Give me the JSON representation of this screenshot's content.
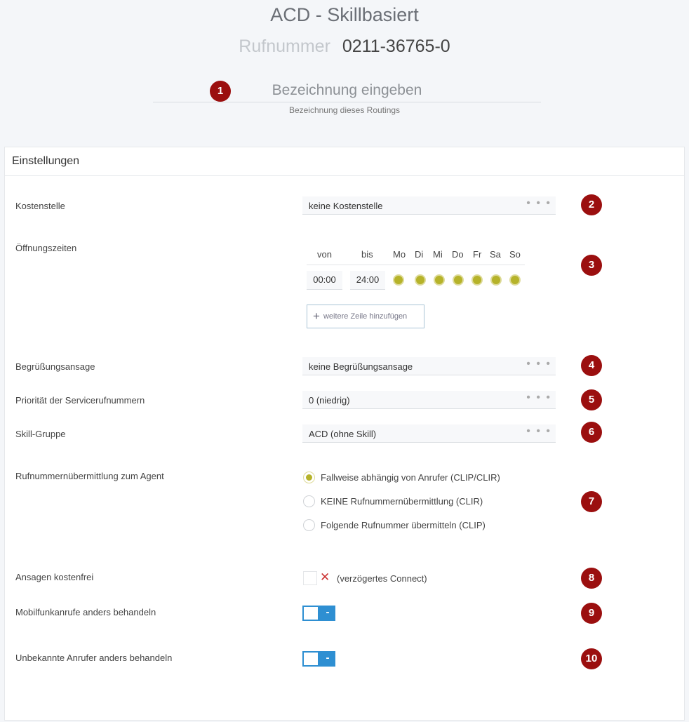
{
  "header": {
    "title": "ACD - Skillbasiert",
    "phone_label": "Rufnummer",
    "phone_value": "0211-36765-0",
    "name_placeholder": "Bezeichnung eingeben",
    "name_hint": "Bezeichnung dieses Routings"
  },
  "badges": [
    "1",
    "2",
    "3",
    "4",
    "5",
    "6",
    "7",
    "8",
    "9",
    "10"
  ],
  "panel": {
    "title": "Einstellungen"
  },
  "settings": {
    "cost_center": {
      "label": "Kostenstelle",
      "value": "keine Kostenstelle"
    },
    "opening_hours": {
      "label": "Öffnungszeiten",
      "col_from": "von",
      "col_to": "bis",
      "days": [
        "Mo",
        "Di",
        "Mi",
        "Do",
        "Fr",
        "Sa",
        "So"
      ],
      "from": "00:00",
      "to": "24:00",
      "add_row_label": "weitere Zeile hinzufügen"
    },
    "greeting": {
      "label": "Begrüßungsansage",
      "value": "keine Begrüßungsansage"
    },
    "priority": {
      "label": "Priorität der Servicerufnummern",
      "value": "0 (niedrig)"
    },
    "skill_group": {
      "label": "Skill-Gruppe",
      "value": "ACD (ohne Skill)"
    },
    "caller_id": {
      "label": "Rufnummernübermittlung zum Agent",
      "options": [
        "Fallweise abhängig von Anrufer (CLIP/CLIR)",
        "KEINE Rufnummernübermittlung (CLIR)",
        "Folgende Rufnummer übermitteln (CLIP)"
      ],
      "selected_index": 0
    },
    "free_announcements": {
      "label": "Ansagen kostenfrei",
      "checkbox_text": "(verzögertes Connect)",
      "checked": false
    },
    "mobile_calls": {
      "label": "Mobilfunkanrufe anders behandeln",
      "state": "-"
    },
    "unknown_callers": {
      "label": "Unbekannte Anrufer anders behandeln",
      "state": "-"
    }
  },
  "colors": {
    "accent": "#2e8fd2",
    "badge": "#9b0f0f",
    "day_active": "#b6b32a"
  }
}
